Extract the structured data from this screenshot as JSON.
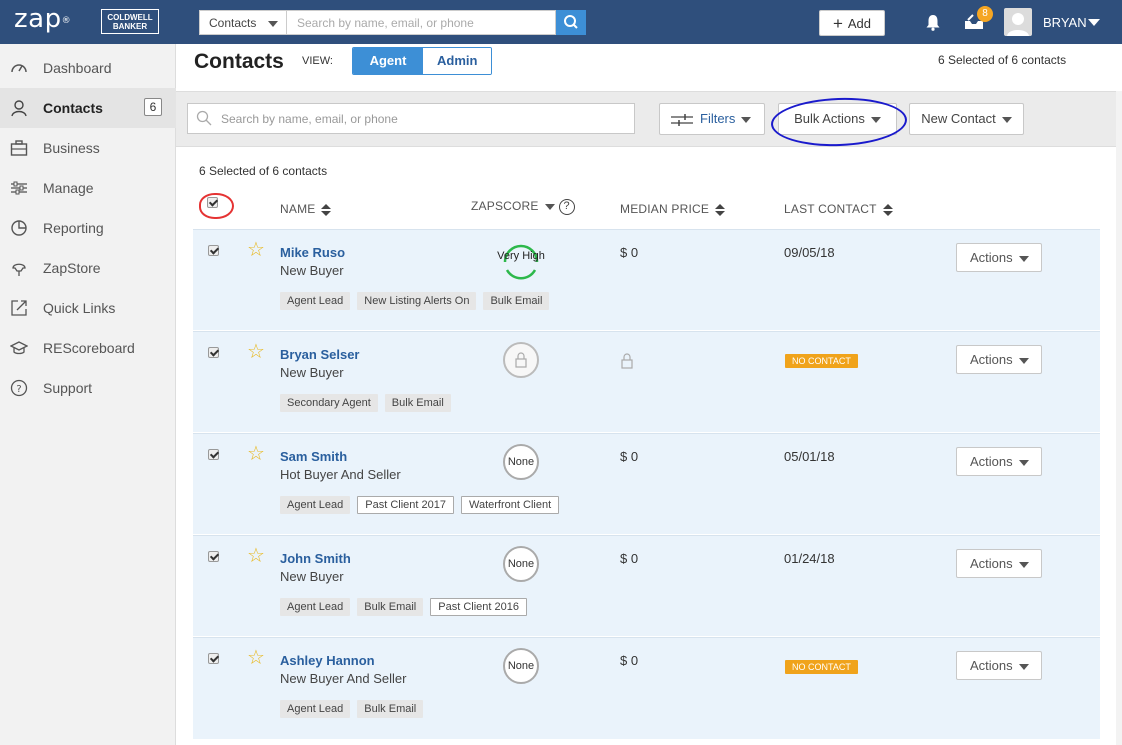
{
  "topbar": {
    "logo": "zap",
    "logo_mark": "®",
    "brand_badge_line1": "COLDWELL",
    "brand_badge_line2": "BANKER",
    "search_scope": "Contacts",
    "search_placeholder": "Search by name, email, or phone",
    "add_label": "Add",
    "notification_count": "8",
    "user_name": "BRYAN"
  },
  "sidebar": {
    "items": [
      {
        "label": "Dashboard",
        "icon": "speedometer-icon"
      },
      {
        "label": "Contacts",
        "icon": "person-icon",
        "count": "6"
      },
      {
        "label": "Business",
        "icon": "briefcase-icon"
      },
      {
        "label": "Manage",
        "icon": "sliders-icon"
      },
      {
        "label": "Reporting",
        "icon": "pie-chart-icon"
      },
      {
        "label": "ZapStore",
        "icon": "store-icon"
      },
      {
        "label": "Quick Links",
        "icon": "external-link-icon"
      },
      {
        "label": "REScoreboard",
        "icon": "graduation-cap-icon"
      },
      {
        "label": "Support",
        "icon": "help-icon"
      }
    ]
  },
  "header": {
    "title": "Contacts",
    "view_label": "VIEW:",
    "view_agent": "Agent",
    "view_admin": "Admin",
    "selected_summary": "6 Selected of 6 contacts"
  },
  "toolbar": {
    "search_placeholder": "Search by name, email, or phone",
    "filters_label": "Filters",
    "bulk_actions_label": "Bulk Actions",
    "new_contact_label": "New Contact"
  },
  "table": {
    "selected_label": "6 Selected of 6 contacts",
    "columns": {
      "name": "NAME",
      "zapscore": "ZAPSCORE",
      "zapscore_help": "?",
      "median_price": "MEDIAN PRICE",
      "last_contact": "LAST CONTACT"
    },
    "actions_label": "Actions",
    "rows": [
      {
        "name": "Mike Ruso",
        "type": "New Buyer",
        "zapscore": "Very High",
        "price": "$ 0",
        "last_contact": "09/05/18",
        "tags": [
          {
            "t": "Agent Lead"
          },
          {
            "t": "New Listing Alerts On"
          },
          {
            "t": "Bulk Email"
          }
        ]
      },
      {
        "name": "Bryan Selser",
        "type": "New Buyer",
        "zapscore": "",
        "price": "",
        "last_contact": "NO CONTACT",
        "tags": [
          {
            "t": "Secondary Agent"
          },
          {
            "t": "Bulk Email"
          }
        ]
      },
      {
        "name": "Sam Smith",
        "type": "Hot Buyer And Seller",
        "zapscore": "None",
        "price": "$ 0",
        "last_contact": "05/01/18",
        "tags": [
          {
            "t": "Agent Lead"
          },
          {
            "t": "Past Client 2017"
          },
          {
            "t": "Waterfront Client"
          }
        ]
      },
      {
        "name": "John Smith",
        "type": "New Buyer",
        "zapscore": "None",
        "price": "$ 0",
        "last_contact": "01/24/18",
        "tags": [
          {
            "t": "Agent Lead"
          },
          {
            "t": "Bulk Email"
          },
          {
            "t": "Past Client 2016"
          }
        ]
      },
      {
        "name": "Ashley Hannon",
        "type": "New Buyer And Seller",
        "zapscore": "None",
        "price": "$ 0",
        "last_contact": "NO CONTACT",
        "tags": [
          {
            "t": "Agent Lead"
          },
          {
            "t": "Bulk Email"
          }
        ]
      }
    ]
  },
  "colors": {
    "topbar": "#2f4f7c",
    "accent_blue": "#3d8fd6",
    "link_blue": "#2a5f9e",
    "no_contact_orange": "#f0a31b",
    "row_bg": "#eaf3fb",
    "very_high_green": "#2db84b",
    "annotation_red": "#e53333",
    "annotation_blue": "#1a1acc"
  }
}
